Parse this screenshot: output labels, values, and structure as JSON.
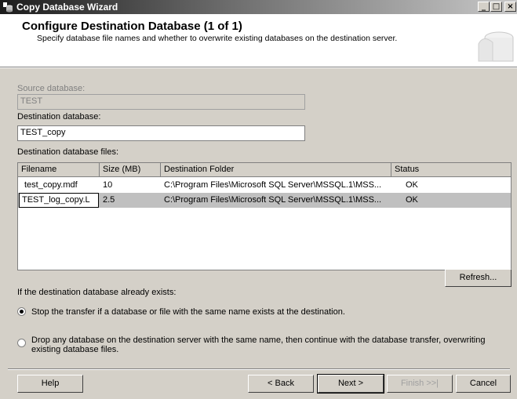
{
  "window": {
    "title": "Copy Database Wizard",
    "controls": {
      "minimize": "_",
      "maximize": "□",
      "close": "×"
    }
  },
  "header": {
    "title": "Configure Destination Database (1 of 1)",
    "subtitle": "Specify database file names and whether to overwrite existing databases on the destination server."
  },
  "form": {
    "source_label": "Source database:",
    "source_value": "TEST",
    "destination_label": "Destination database:",
    "destination_value": "TEST_copy",
    "files_label": "Destination database files:"
  },
  "files_table": {
    "columns": [
      "Filename",
      "Size (MB)",
      "Destination Folder",
      "Status"
    ],
    "rows": [
      {
        "filename": "test_copy.mdf",
        "size": "10",
        "folder": "C:\\Program Files\\Microsoft SQL Server\\MSSQL.1\\MSS...",
        "status": "OK"
      },
      {
        "filename": "TEST_log_copy.L",
        "size": "2.5",
        "folder": "C:\\Program Files\\Microsoft SQL Server\\MSSQL.1\\MSS...",
        "status": "OK"
      }
    ]
  },
  "refresh_label": "Refresh...",
  "exists": {
    "label": "If the destination database already exists:",
    "option_stop": "Stop the transfer if a database or file with the same name exists at the destination.",
    "option_drop_line1": "Drop any database on the destination server with the same name, then continue with the database transfer, overwriting",
    "option_drop_line2": "existing database files.",
    "selected": "stop"
  },
  "footer": {
    "help": "Help",
    "back": "< Back",
    "next": "Next >",
    "finish": "Finish >>|",
    "cancel": "Cancel"
  }
}
